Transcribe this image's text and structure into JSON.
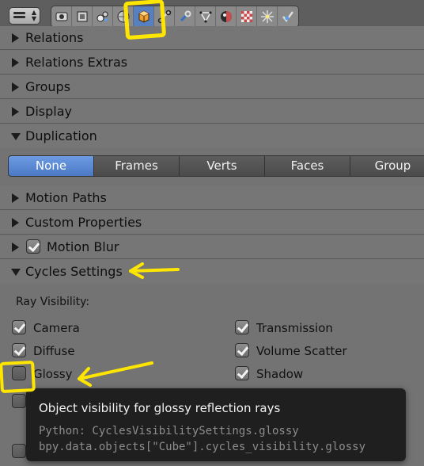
{
  "toolbar": {
    "editor_icon": "properties-editor-icon",
    "tabs": [
      {
        "icon": "render-icon",
        "active": false
      },
      {
        "icon": "render-layers-icon",
        "active": false
      },
      {
        "icon": "scene-icon",
        "active": false
      },
      {
        "icon": "world-icon",
        "active": false
      },
      {
        "icon": "object-icon",
        "active": true
      },
      {
        "icon": "constraints-icon",
        "active": false
      },
      {
        "icon": "modifiers-icon",
        "active": false
      },
      {
        "icon": "object-data-icon",
        "active": false
      },
      {
        "icon": "material-icon",
        "active": false
      },
      {
        "icon": "texture-icon",
        "active": false
      },
      {
        "icon": "particles-icon",
        "active": false
      },
      {
        "icon": "physics-icon",
        "active": false
      }
    ]
  },
  "panels": {
    "relations": "Relations",
    "relations_extras": "Relations Extras",
    "groups": "Groups",
    "display": "Display",
    "duplication": "Duplication",
    "motion_paths": "Motion Paths",
    "custom_properties": "Custom Properties",
    "motion_blur": "Motion Blur",
    "cycles_settings": "Cycles Settings"
  },
  "duplication": {
    "options": [
      "None",
      "Frames",
      "Verts",
      "Faces",
      "Group"
    ],
    "selected": "None"
  },
  "cycles": {
    "ray_visibility_label": "Ray Visibility:",
    "camera": {
      "label": "Camera",
      "checked": true
    },
    "diffuse": {
      "label": "Diffuse",
      "checked": true
    },
    "glossy": {
      "label": "Glossy",
      "checked": false
    },
    "transmission": {
      "label": "Transmission",
      "checked": true
    },
    "volume_scatter": {
      "label": "Volume Scatter",
      "checked": true
    },
    "shadow": {
      "label": "Shadow",
      "checked": true
    }
  },
  "tooltip": {
    "text": "Object visibility for glossy reflection rays",
    "python_line1": "Python: CyclesVisibilitySettings.glossy",
    "python_line2": "bpy.data.objects[\"Cube\"].cycles_visibility.glossy"
  },
  "colors": {
    "selected_blue": "#5680c2",
    "annotation_yellow": "#ffe600",
    "tooltip_bg": "#1f1f1f"
  }
}
